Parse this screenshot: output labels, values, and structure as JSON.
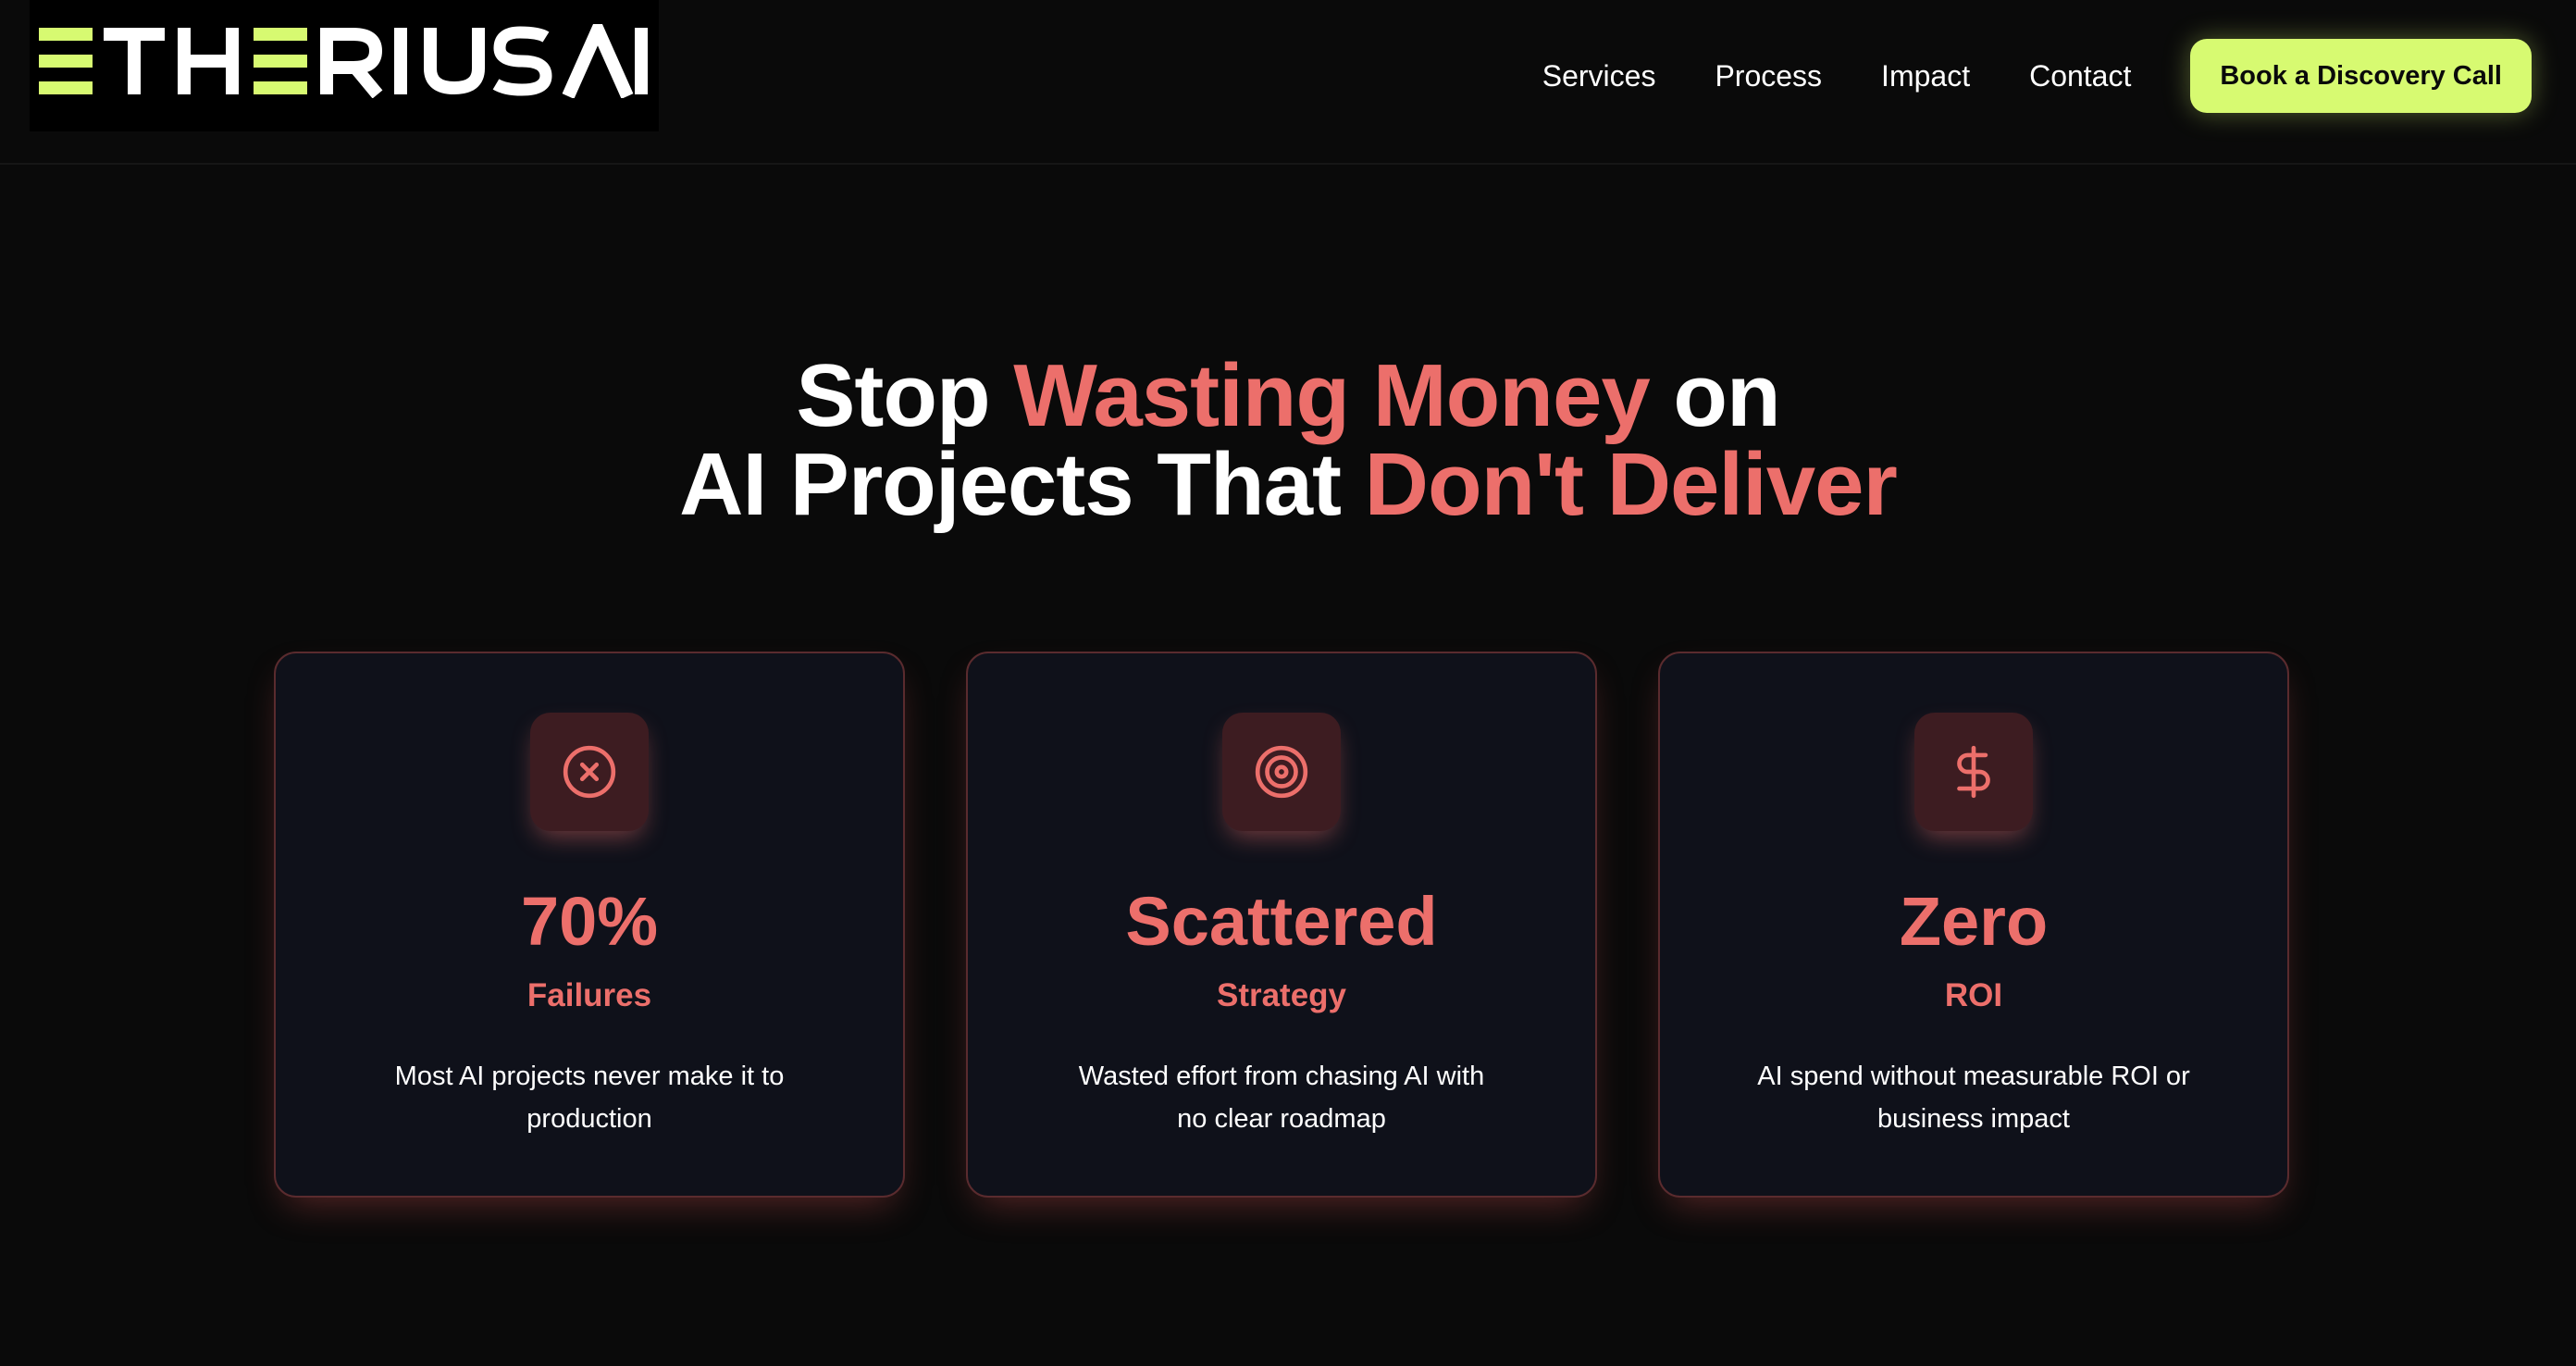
{
  "brand": {
    "logo_text": "ETHERIUS AI",
    "accent_color": "#d7fa71"
  },
  "nav": {
    "links": [
      "Services",
      "Process",
      "Impact",
      "Contact"
    ],
    "cta_label": "Book a Discovery Call"
  },
  "hero": {
    "line1": {
      "part1": "Stop ",
      "accent": "Wasting Money",
      "part2": " on"
    },
    "line2": {
      "part1": "AI Projects That ",
      "accent": "Don't Deliver"
    },
    "accent_color": "#ec6f6b"
  },
  "cards": [
    {
      "icon": "x-circle-icon",
      "stat": "70%",
      "label": "Failures",
      "description": "Most AI projects never make it to production"
    },
    {
      "icon": "target-icon",
      "stat": "Scattered",
      "label": "Strategy",
      "description": "Wasted effort from chasing AI with no clear roadmap"
    },
    {
      "icon": "dollar-icon",
      "stat": "Zero",
      "label": "ROI",
      "description": "AI spend without measurable ROI or business impact"
    }
  ]
}
